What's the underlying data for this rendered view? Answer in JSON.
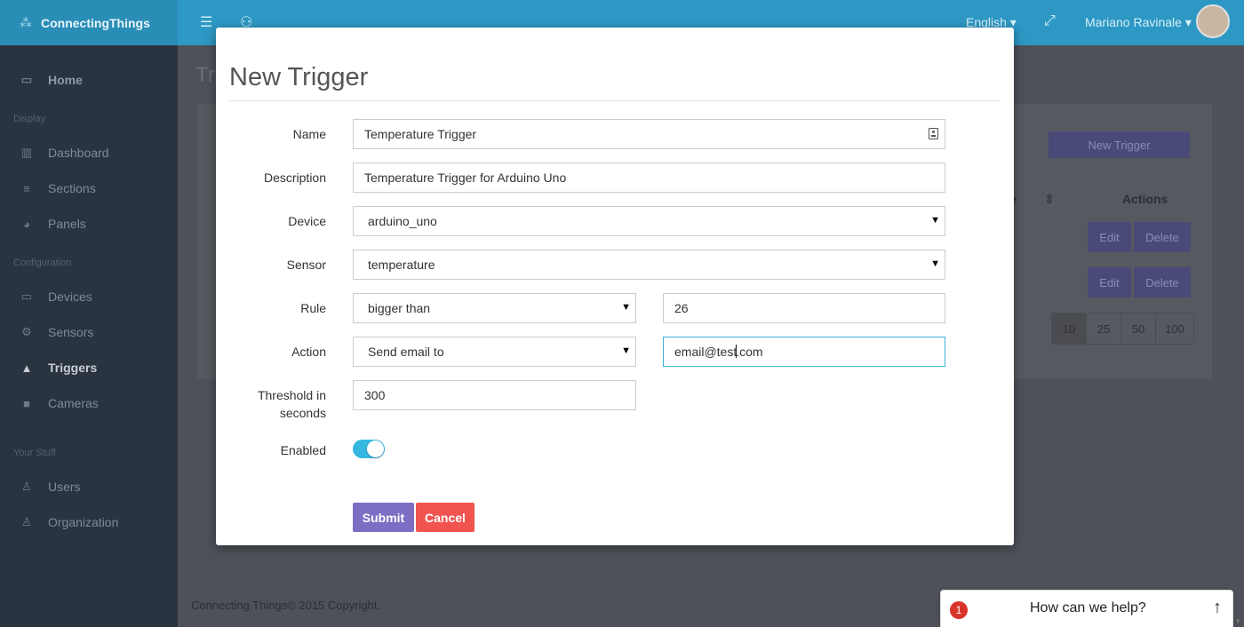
{
  "topbar": {
    "brand": "ConnectingThings",
    "language": "English",
    "user_name": "Mariano Ravinale",
    "menu_icon": "hamburger-icon",
    "profile_icon": "user-icon",
    "fullscreen_icon": "expand-icon"
  },
  "sidebar": {
    "home": "Home",
    "heading_display": "Display",
    "dashboard": "Dashboard",
    "sections": "Sections",
    "panels": "Panels",
    "heading_configuration": "Configuration",
    "devices": "Devices",
    "sensors": "Sensors",
    "triggers": "Triggers",
    "cameras": "Cameras",
    "heading_your_stuff": "Your Stuff",
    "users": "Users",
    "organization": "Organization"
  },
  "background": {
    "page_title": "Tr",
    "new_trigger_button": "New Trigger",
    "col_fragment": "e",
    "actions_header": "Actions",
    "edit": "Edit",
    "delete": "Delete",
    "page_sizes": [
      "10",
      "25",
      "50",
      "100"
    ],
    "footer": "Connecting Things© 2015 Copyright."
  },
  "modal": {
    "title": "New Trigger",
    "name_label": "Name",
    "name_value": "Temperature Trigger",
    "description_label": "Description",
    "description_value": "Temperature Trigger for Arduino Uno",
    "device_label": "Device",
    "device_value": "arduino_uno",
    "sensor_label": "Sensor",
    "sensor_value": "temperature",
    "rule_label": "Rule",
    "rule_value": "bigger than",
    "rule_threshold_value": "26",
    "action_label": "Action",
    "action_value": "Send email to",
    "email_before_cursor": "email@test",
    "email_after_cursor": ".com",
    "threshold_label_line1": "Threshold in",
    "threshold_label_line2": "seconds",
    "threshold_value": "300",
    "enabled_label": "Enabled",
    "enabled": true,
    "submit": "Submit",
    "cancel": "Cancel"
  },
  "help_widget": {
    "badge_count": "1",
    "text": "How can we help?"
  },
  "colors": {
    "topbar": "#2d98c4",
    "submit": "#7d6ec4",
    "cancel": "#f1544f",
    "toggle_on": "#35b7e0"
  }
}
